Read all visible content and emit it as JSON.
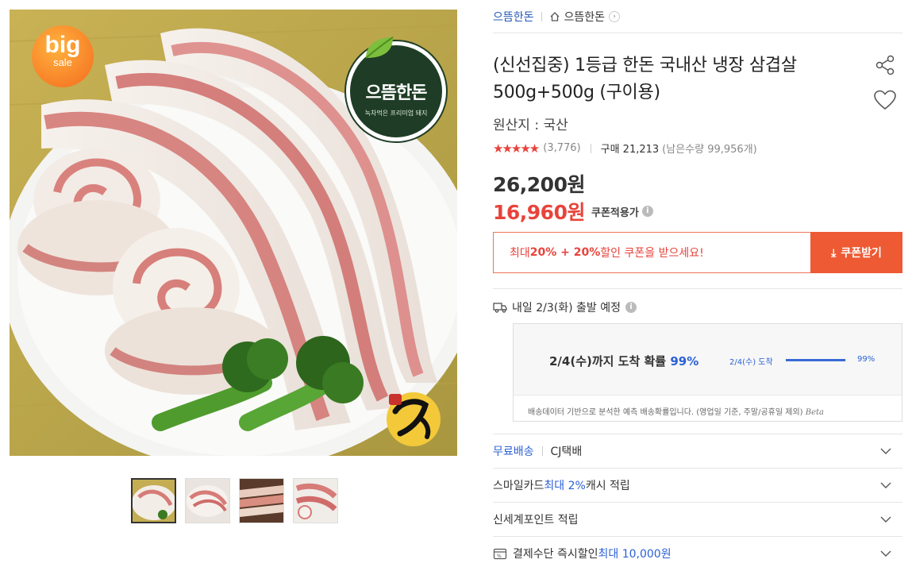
{
  "image": {
    "badge": {
      "big": "big",
      "sale": "sale"
    },
    "logo": {
      "name": "으뜸한돈",
      "sub": "녹차먹은 프리미엄 돼지",
      "leaf_text": "초록잎"
    },
    "seal": {
      "text": "한돈"
    },
    "thumbnails": [
      "thumb-1",
      "thumb-2",
      "thumb-3",
      "thumb-4"
    ]
  },
  "breadcrumb": {
    "brand": "으뜸한돈",
    "store": "으뜸한돈",
    "arrow": "›"
  },
  "product": {
    "title": "(신선집중) 1등급 한돈 국내산 냉장 삼겹살 500g+500g (구이용)",
    "origin": "원산지 : 국산",
    "stars": "★★★★★",
    "review_count": "(3,776)",
    "purchase_label": "구매 21,213",
    "stock": "(남은수량 99,956개)",
    "original_price": "26,200원",
    "sale_price": "16,960원",
    "coupon_applied": "쿠폰적용가",
    "info_icon": "i"
  },
  "coupon": {
    "prefix": "최대 ",
    "bold": "20% + 20%",
    "suffix": " 할인 쿠폰을 받으세요!",
    "button_icon": "⤓",
    "button_label": "쿠폰받기"
  },
  "shipping": {
    "label": "내일 2/3(화) 출발 예정",
    "forecast_main": "2/4(수)까지 도착 확률 ",
    "forecast_pct": "99%",
    "bar_label": "2/4(수) 도착",
    "bar_pct": "99%",
    "bar_fraction": 0.99,
    "note": "배송데이터 기반으로 분석한 예측 배송확률입니다. (영업일 기준, 주말/공휴일 제외) ",
    "beta": "Beta"
  },
  "options": {
    "delivery_free": "무료배송",
    "delivery_courier": "CJ택배",
    "smile_prefix": "스마일카드 ",
    "smile_blue": "최대 2%",
    "smile_suffix": " 캐시 적립",
    "shinsegae": "신세계포인트 적립",
    "payment_prefix": "결제수단 즉시할인 ",
    "payment_blue": "최대 10,000원"
  }
}
